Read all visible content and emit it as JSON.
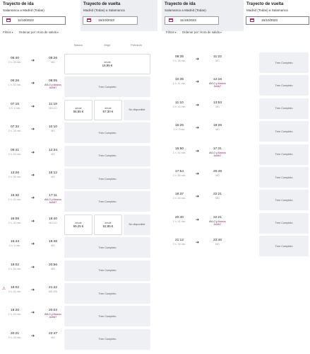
{
  "outbound": {
    "title": "Trayecto de ida",
    "route": "Salamanca a Madrid (Todas)",
    "date": "11/10/2023"
  },
  "return_tab": {
    "title": "Trayecto de vuelta",
    "route": "Madrid (Todas) a Salamanca",
    "date": "15/10/2023"
  },
  "outbound_tab_right": {
    "title": "Trayecto de ida",
    "route": "Salamanca a Madrid (Todas)",
    "date": "11/10/2023"
  },
  "return_active": {
    "title": "Trayecto de vuelta",
    "route": "Madrid (Todas) a Salamanca",
    "date": "15/10/2023"
  },
  "filters": {
    "filter_label": "Filtros",
    "sort_label": "Ordenar por: Hora de salida"
  },
  "columns": {
    "basic": "Básico",
    "choose": "Elige",
    "premium": "Prémium"
  },
  "labels": {
    "full": "Tren Completo",
    "from": "desde",
    "unavailable": "No disponible",
    "avlo": "AVLO y",
    "avant": "Abonos AVANT"
  },
  "left_rows": [
    {
      "dep": "05:40",
      "dur": "2 h. 29 min.",
      "arr": "08:26",
      "station": "MD",
      "type": "basic",
      "basic_price": "16,95 €"
    },
    {
      "dep": "06:26",
      "dur": "1 h. 40 min.",
      "arr": "08:05",
      "station": "",
      "avlo": true,
      "type": "full"
    },
    {
      "dep": "07:15",
      "dur": "4 h. 4 min.",
      "arr": "11:19",
      "station": "MD-LD",
      "type": "three",
      "basic_price": "56,55 €",
      "choose_price": "67,30 €"
    },
    {
      "dep": "07:32",
      "dur": "2 h. 28 min.",
      "arr": "10:10",
      "station": "MD",
      "type": "full"
    },
    {
      "dep": "09:41",
      "dur": "2 h. 53 min.",
      "arr": "12:34",
      "station": "MD",
      "type": "full"
    },
    {
      "dep": "13:26",
      "dur": "2 h. 46 min.",
      "arr": "15:12",
      "station": "MD",
      "type": "full"
    },
    {
      "dep": "15:30",
      "dur": "1 h. 40 min.",
      "arr": "17:11",
      "station": "",
      "avlo": true,
      "type": "full"
    },
    {
      "dep": "16:08",
      "dur": "2 h. 30 min.",
      "arr": "18:40",
      "station": "MD-LD",
      "type": "three",
      "basic_price": "59,25 €",
      "choose_price": "62,85 €"
    },
    {
      "dep": "16:44",
      "dur": "3 h. 5 min.",
      "arr": "19:48",
      "station": "MD",
      "type": "full"
    },
    {
      "dep": "18:02",
      "dur": "2 h. 54 min.",
      "arr": "20:56",
      "station": "MD",
      "type": "full"
    },
    {
      "dep": "18:02",
      "dur": "3 h. 41 min.",
      "arr": "21:42",
      "station": "MD-MD",
      "type": "full",
      "warn": true
    },
    {
      "dep": "18:20",
      "dur": "1 h. 43 min.",
      "arr": "20:03",
      "station": "",
      "avlo": true,
      "type": "full"
    },
    {
      "dep": "20:21",
      "dur": "2 h. 26 min.",
      "arr": "22:47",
      "station": "MD",
      "type": "full"
    }
  ],
  "right_rows": [
    {
      "dep": "08:35",
      "dur": "2 h. 35 min.",
      "arr": "11:23",
      "station": "MD"
    },
    {
      "dep": "10:35",
      "dur": "1 h. 41 min.",
      "arr": "12:16",
      "station": "",
      "avlo": true
    },
    {
      "dep": "11:10",
      "dur": "2 h. 43 min.",
      "arr": "13:53",
      "station": "MD"
    },
    {
      "dep": "16:25",
      "dur": "2 h. 3 min.",
      "arr": "18:28",
      "station": "MD"
    },
    {
      "dep": "15:50",
      "dur": "1 h. 41 min.",
      "arr": "17:31",
      "station": "",
      "avlo": true
    },
    {
      "dep": "17:54",
      "dur": "2 h. 55 min.",
      "arr": "20:49",
      "station": "MD"
    },
    {
      "dep": "19:37",
      "dur": "2 h. 44 min.",
      "arr": "22:21",
      "station": "MD"
    },
    {
      "dep": "20:40",
      "dur": "1 h. 41 min.",
      "arr": "22:21",
      "station": "",
      "avlo": true
    },
    {
      "dep": "21:12",
      "dur": "2 h. 34 min.",
      "arr": "23:46",
      "station": "MD"
    }
  ]
}
